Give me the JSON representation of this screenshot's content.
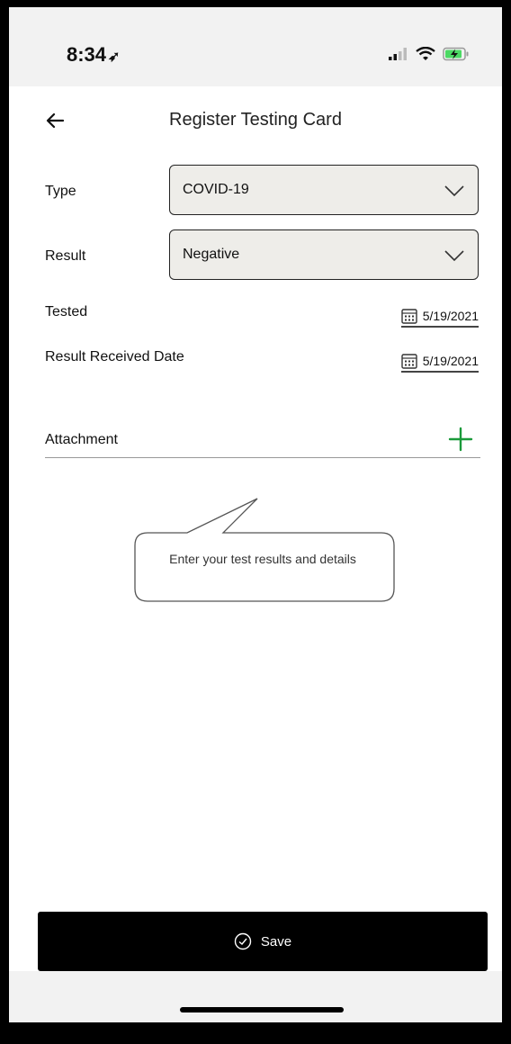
{
  "status_bar": {
    "time": "8:34",
    "location_icon": "location-arrow-icon",
    "signal_icon": "cellular-signal-icon",
    "wifi_icon": "wifi-icon",
    "battery_icon": "battery-charging-icon",
    "battery_color": "#4cd964"
  },
  "header": {
    "back_icon": "back-arrow-icon",
    "title": "Register Testing Card"
  },
  "form": {
    "type": {
      "label": "Type",
      "value": "COVID-19"
    },
    "result": {
      "label": "Result",
      "value": "Negative"
    },
    "tested": {
      "label": "Tested",
      "date": "5/19/2021"
    },
    "result_received": {
      "label": "Result Received Date",
      "date": "5/19/2021"
    },
    "attachment": {
      "label": "Attachment",
      "add_icon": "plus-icon",
      "accent": "#1a9a3a"
    }
  },
  "tooltip": {
    "text": "Enter your test results and details"
  },
  "footer": {
    "save_label": "Save",
    "save_icon": "check-circle-icon"
  }
}
